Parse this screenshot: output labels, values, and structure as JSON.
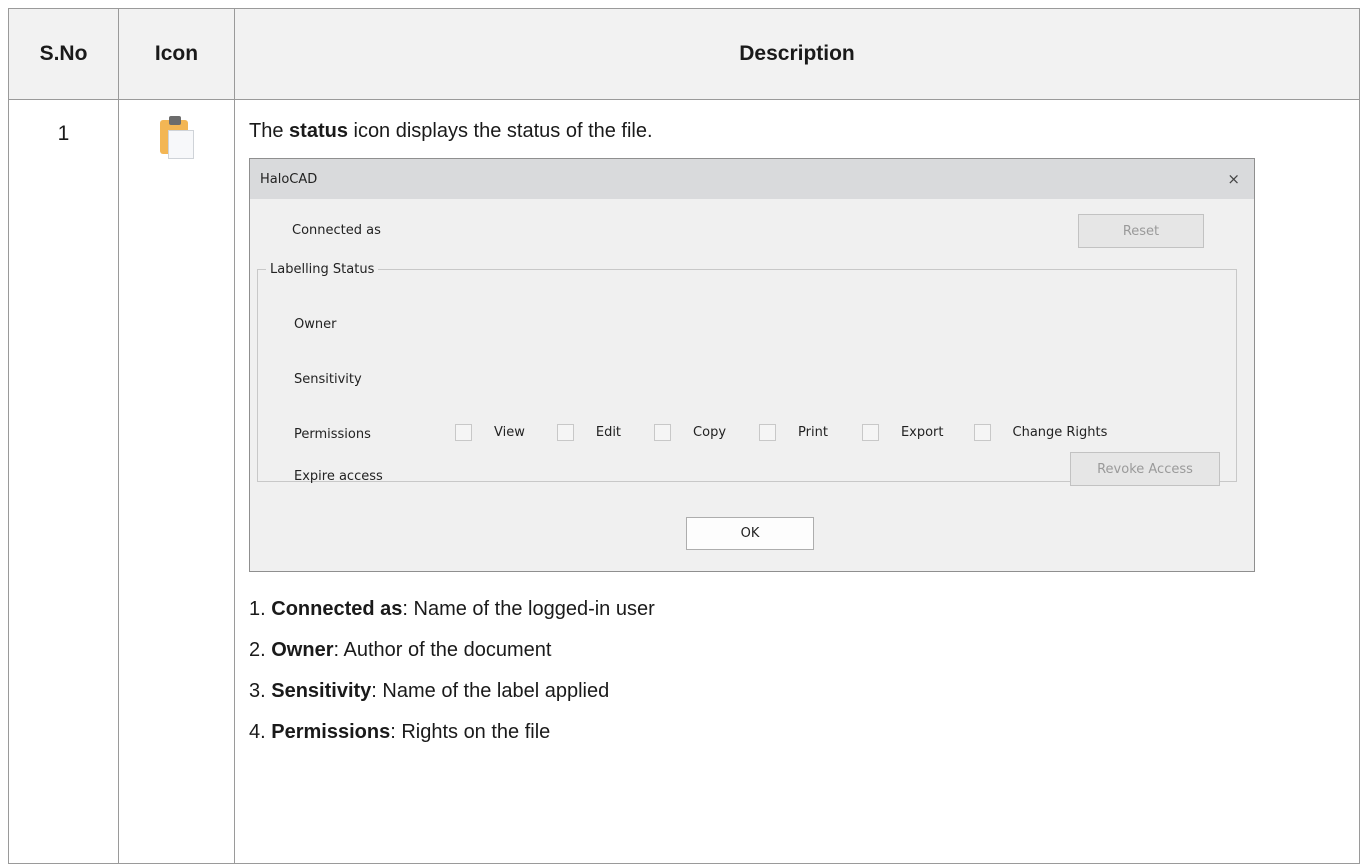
{
  "table": {
    "headers": [
      "S.No",
      "Icon",
      "Description"
    ],
    "row": {
      "sno": "1",
      "icon": "clipboard-status-icon",
      "intro": {
        "pre": "The ",
        "bold": "status",
        "post": " icon displays the status of the file."
      },
      "dialog": {
        "title": "HaloCAD",
        "close": "×",
        "connected_as": "Connected as",
        "reset": "Reset",
        "group_label": "Labelling Status",
        "owner": "Owner",
        "sensitivity": "Sensitivity",
        "permissions": "Permissions",
        "perm_options": [
          "View",
          "Edit",
          "Copy",
          "Print",
          "Export",
          "Change Rights"
        ],
        "expire_access": "Expire access",
        "revoke": "Revoke Access",
        "ok": "OK"
      },
      "definitions": [
        {
          "num": "1. ",
          "term": "Connected as",
          "desc": ": Name of the logged-in user"
        },
        {
          "num": "2. ",
          "term": "Owner",
          "desc": ": Author of the document"
        },
        {
          "num": "3. ",
          "term": "Sensitivity",
          "desc": ": Name of the label applied"
        },
        {
          "num": "4. ",
          "term": "Permissions",
          "desc": ": Rights on the file"
        }
      ]
    }
  }
}
